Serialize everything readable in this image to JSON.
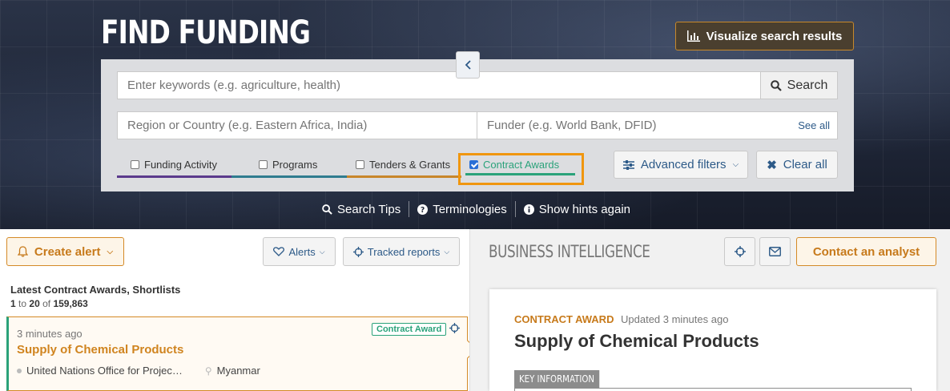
{
  "header": {
    "title": "FIND FUNDING",
    "visualize_label": "Visualize search results"
  },
  "search": {
    "keywords_placeholder": "Enter keywords (e.g. agriculture, health)",
    "search_label": "Search",
    "region_placeholder": "Region or Country (e.g. Eastern Africa, India)",
    "funder_placeholder": "Funder (e.g. World Bank, DFID)",
    "see_all_label": "See all"
  },
  "tabs": [
    {
      "label": "Funding Activity",
      "checked": false,
      "color": "#5b3a8c"
    },
    {
      "label": "Programs",
      "checked": false,
      "color": "#2f7c8f"
    },
    {
      "label": "Tenders & Grants",
      "checked": false,
      "color": "#c8862a"
    },
    {
      "label": "Contract Awards",
      "checked": true,
      "color": "#2aa27a"
    }
  ],
  "filters": {
    "advanced_label": "Advanced filters",
    "clear_label": "Clear all"
  },
  "hints": {
    "search_tips": "Search Tips",
    "terminologies": "Terminologies",
    "show_hints": "Show hints again"
  },
  "left": {
    "create_alert_label": "Create alert",
    "alerts_label": "Alerts",
    "tracked_label": "Tracked reports",
    "list_title": "Latest Contract Awards, Shortlists",
    "count_from": "1",
    "count_to_word": "to",
    "count_to": "20",
    "count_of_word": "of",
    "count_total": "159,863",
    "result": {
      "time": "3 minutes ago",
      "badge": "Contract Award",
      "title": "Supply of Chemical Products",
      "org": "United Nations Office for Projec…",
      "location": "Myanmar"
    }
  },
  "right": {
    "section_title": "BUSINESS INTELLIGENCE",
    "contact_label": "Contact an analyst",
    "detail": {
      "type": "CONTRACT AWARD",
      "updated": "Updated 3 minutes ago",
      "title": "Supply of Chemical Products",
      "key_info": "KEY INFORMATION"
    }
  },
  "colors": {
    "accent_orange": "#d48a27",
    "link_blue": "#2d5a88",
    "contract_green": "#2aa27a",
    "highlight": "#f0960f"
  }
}
